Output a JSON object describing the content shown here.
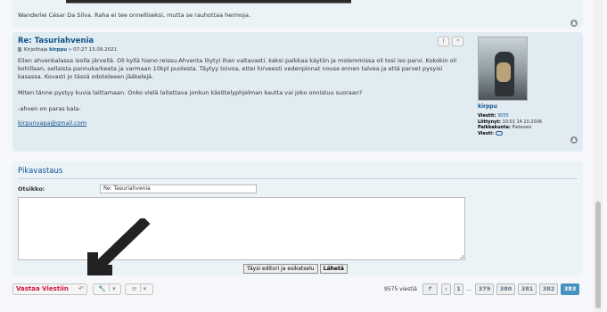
{
  "previous_post": {
    "text": "Wanderlei César Da Silva. Raha ei tee onnelliseksi, mutta se rauhottaa hermoja."
  },
  "post": {
    "title": "Re: Tasuriahvenia",
    "meta_prefix": "Kirjoittaja",
    "author": "kirppu",
    "meta_date": "» 07:27 13.09.2021",
    "paragraphs": [
      "Eilen ahvenkalassa isolla järvellä. Oli kyllä hieno reissu.Ahventa löytyi ihan valtavasti. kaksi paikkaa käytiin ja molemmissa oli tosi iso parvi. Kokokin oli kohillaan, sellaista pannukarkeeta ja varmaan 10kpl puolesta. Täytyy toivoa, ettei hirveesti vedenpinnat nouse ennen talvea ja että parvet pysyisi kasassa. Kovasti jo tässä odoteleeen jääkelejä.",
      "Miten tänne pystyy kuvia laittamaan. Onko vielä laitettava jonkun käsittelyphjelman kautta vai joko onnistuu suoraan?",
      "-ahven on paras kala-"
    ],
    "email": "kirpunvapa@gmail.com",
    "buttons": {
      "report": "!",
      "quote": "❝"
    }
  },
  "profile": {
    "name": "kirppu",
    "posts_label": "Viestit:",
    "posts_value": "3055",
    "joined_label": "Liittynyt:",
    "joined_value": "10:01 14.10.2006",
    "location_label": "Paikkakunta:",
    "location_value": "Pielavesi",
    "message_label": "Viesti:"
  },
  "quick_reply": {
    "title": "Pikavastaus",
    "subject_label": "Otsikko:",
    "subject_value": "Re: Tasuriahvenia",
    "full_editor_button": "Täysi editori ja esikatselu",
    "submit_button": "Lähetä"
  },
  "toolbar": {
    "reply_button": "Vastaa Viestiin",
    "post_count": "9575 viestiä",
    "pages": [
      "1",
      "379",
      "380",
      "381",
      "382",
      "383"
    ],
    "current_page": "383",
    "ellipsis": "…"
  },
  "icons": {
    "reply": "reply-icon",
    "tools": "wrench-icon",
    "sort": "sort-icon",
    "back_to_top": "chevron-up-icon",
    "jump": "jump-icon",
    "prev": "chevron-left-icon"
  },
  "colors": {
    "title_blue": "#105289",
    "reply_red": "#d31141",
    "active_page": "#4692bf"
  }
}
